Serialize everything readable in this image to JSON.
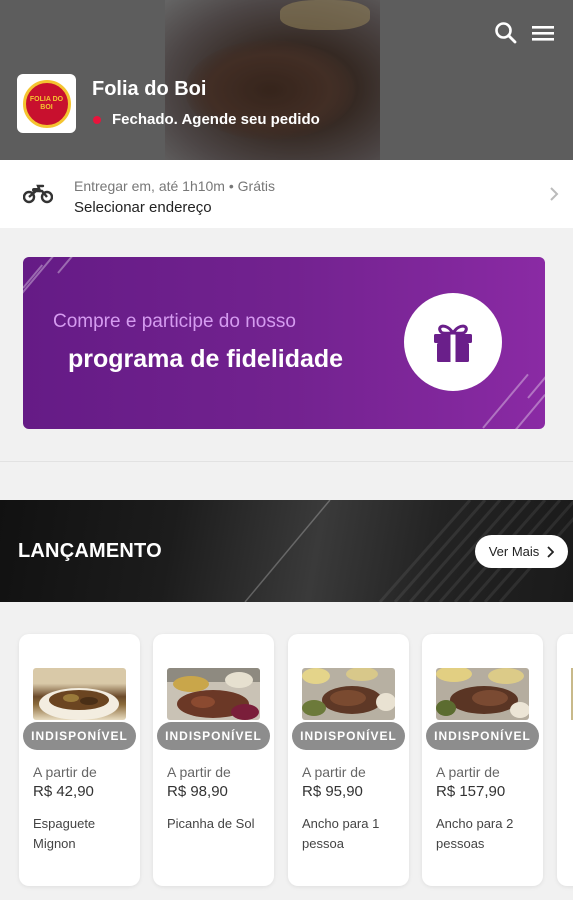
{
  "store": {
    "name": "Folia do Boi",
    "status": "Fechado. Agende seu pedido",
    "status_color": "#e8143c",
    "logo_text": "FOLIA DO BOI"
  },
  "header_icons": [
    "search-icon",
    "menu-icon"
  ],
  "delivery": {
    "line1": "Entregar em, até 1h10m • Grátis",
    "line2": "Selecionar endereço",
    "icon": "motorcycle-icon"
  },
  "loyalty": {
    "line1": "Compre e participe do nosso",
    "line2": "programa de fidelidade",
    "icon": "gift-icon",
    "color": "#72228f"
  },
  "launch": {
    "title": "LANÇAMENTO",
    "button": "Ver Mais"
  },
  "products": [
    {
      "badge": "INDISPONÍVEL",
      "from": "A partir de",
      "price": "R$ 42,90",
      "name": "Espaguete Mignon"
    },
    {
      "badge": "INDISPONÍVEL",
      "from": "A partir de",
      "price": "R$ 98,90",
      "name": "Picanha de Sol"
    },
    {
      "badge": "INDISPONÍVEL",
      "from": "A partir de",
      "price": "R$ 95,90",
      "name": "Ancho para 1 pessoa"
    },
    {
      "badge": "INDISPONÍVEL",
      "from": "A partir de",
      "price": "R$ 157,90",
      "name": "Ancho para 2 pessoas"
    }
  ]
}
